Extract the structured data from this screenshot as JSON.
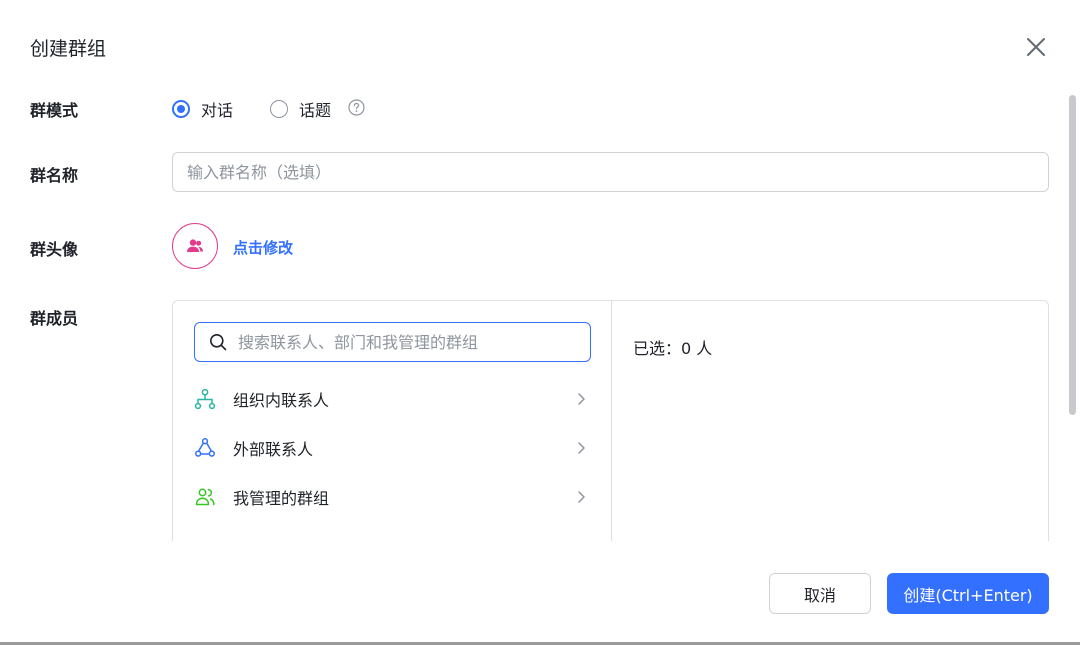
{
  "dialog": {
    "title": "创建群组"
  },
  "group_mode": {
    "label": "群模式",
    "options": [
      {
        "label": "对话",
        "selected": true
      },
      {
        "label": "话题",
        "selected": false
      }
    ]
  },
  "group_name": {
    "label": "群名称",
    "placeholder": "输入群名称（选填）",
    "value": ""
  },
  "group_avatar": {
    "label": "群头像",
    "edit_link": "点击修改",
    "color": "#e33a8c"
  },
  "group_members": {
    "label": "群成员",
    "search_placeholder": "搜索联系人、部门和我管理的群组",
    "sources": [
      {
        "label": "组织内联系人",
        "icon": "org-chart-icon",
        "color": "#2bb5a0"
      },
      {
        "label": "外部联系人",
        "icon": "external-contacts-icon",
        "color": "#3370ff"
      },
      {
        "label": "我管理的群组",
        "icon": "managed-groups-icon",
        "color": "#34c724"
      }
    ],
    "selected_text": "已选：0 人"
  },
  "footer": {
    "cancel_label": "取消",
    "create_label": "创建(Ctrl+Enter)"
  },
  "colors": {
    "accent": "#3370ff",
    "border": "#d0d3d6"
  }
}
